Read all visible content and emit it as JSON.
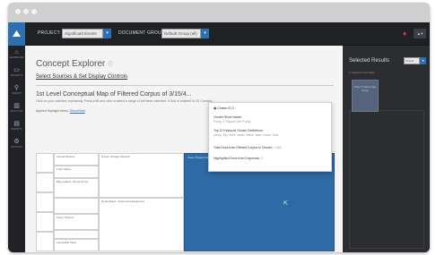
{
  "header": {
    "project_label": "PROJECT:",
    "project_value": "Significant Events",
    "docgroup_label": "DOCUMENT GROUP:",
    "docgroup_value": "Default Group (all)",
    "user_label": "▲▾"
  },
  "sidebar": {
    "items": [
      {
        "label": "DASHBOARD"
      },
      {
        "label": "PROJECTS"
      },
      {
        "label": "SEARCH"
      },
      {
        "label": "ANALYTICS"
      },
      {
        "label": "REPORTS"
      },
      {
        "label": "SETTINGS"
      }
    ]
  },
  "main": {
    "title": "Concept Explorer",
    "title_info": "ⓘ",
    "sources_link": "Select Sources & Set Display Controls",
    "map_title": "1st Level Conceptual Map of Filtered Corpus of 3/15/4...",
    "map_subtitle": "Click on your selection repeatedly. Press shift and click to select a range of the items selected. If Sort is enabled in 2D Concept...",
    "highlight_label": "Applied Highlight Items:",
    "highlight_link": "Show/Hide",
    "reset_button": "Reset",
    "grid": {
      "col_a": [
        "",
        "",
        "",
        "",
        ""
      ],
      "col_b": [
        "Annual Review",
        "From Safety",
        "Bay Leaked - Pump Sump",
        "",
        "Pump Tripped",
        "",
        "Inoperable Valve"
      ],
      "col_c": [
        "Power Change Network",
        "Rods Failed - Instrument Equipment"
      ],
      "blue_label": "Pump Tripped Jan"
    }
  },
  "tooltip": {
    "header": "▣ Cluster ID 3",
    "cluster_label": "Cluster Short Name:",
    "cluster_value": "Pump 3 Tripped Jan Pump",
    "kw_label": "Top 10 Keyword Cluster Definitions:",
    "kw_value": "pump, trip, feed, water, valve, start, motor, flow",
    "docs_label": "Total Docs from Filtered Corpus in Cluster:",
    "docs_value": "1,030",
    "highlight_label": "Highlighted Docs from Keywords:",
    "highlight_value": "0"
  },
  "right_panel": {
    "title": "Selected Results",
    "select_value": "Cluster",
    "subtitle": "1 Groups to Compare",
    "thumb_label": "Pump Tripped Jan Pump"
  }
}
